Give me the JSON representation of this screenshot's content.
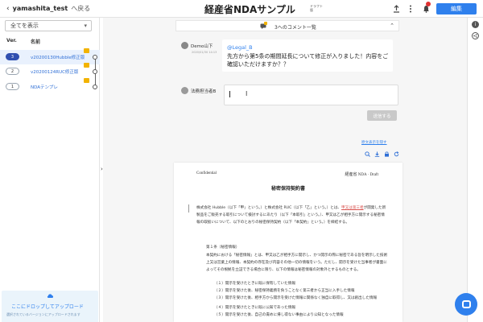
{
  "header": {
    "back_project": "yamashita_test",
    "back_label": "へ戻る",
    "title": "経産省NDAサンプル",
    "title_badge": "ドラフト版",
    "edit_button": "編集",
    "icons": [
      "upload-icon",
      "more-vertical-icon",
      "bell-icon"
    ]
  },
  "sidebar": {
    "filter_value": "全てを表示",
    "columns": {
      "version": "Ver.",
      "name": "名前"
    },
    "versions": [
      {
        "ver": "3",
        "name": "v20200130Hubble修正版",
        "active": true
      },
      {
        "ver": "2",
        "name": "v20200124RUC修正版",
        "active": false
      },
      {
        "ver": "1",
        "name": "NDAテンプレ",
        "active": false
      }
    ],
    "dropzone": {
      "title": "ここにドロップしてアップロード",
      "subtitle": "選択されているバージョンにアップロードされます"
    }
  },
  "comments": {
    "header_label": "3へのコメント一覧",
    "items": [
      {
        "author": "Demo山下",
        "time": "2020/01/30 14:13",
        "mention": "@Legal_B",
        "body": "先方から第5条の期間延長について修正が入りました！内容をご確認いただけますか？？"
      }
    ],
    "reply_author": "法務担当者B",
    "reply_button": "送信する",
    "hide_link": "原文表示を隠す"
  },
  "document": {
    "left_header": "Confidential",
    "right_header": "経産省 NDA · Draft",
    "title": "秘密保持契約書",
    "para_pre": "株式会社 Hubble（以下「甲」という。）と株式会社 RUC（以下「乙」という。）とは、",
    "para_hl": "甲又は第三者",
    "para_post": "が開発した新製品をご販売する取引について検討するにあたり（以下「本取引」という。）、甲又は乙が相手方に開示する秘密情報の取扱いについて、以下のとおりの秘密保持契約（以下「本契約」という。）を締結する。",
    "article_title": "第１条（秘密情報）",
    "article_body": "本契約における「秘密情報」とは、甲又は乙が相手方に開示し、かつ開示の際に秘密である旨を明示した技術上又は営業上の情報、本契約の存在及び内容その他一切の情報をいう。ただし、開示を受けた当事者が書面によってその根拠を立証できる場合に限り、以下の情報は秘密情報の対象外とするものとする。",
    "items": [
      "（１）開示を受けたときに既に保有していた情報",
      "（２）開示を受けた後、秘密保持義務を負うことなく第三者から正当に入手した情報",
      "（３）開示を受けた後、相手方から開示を受けた情報に関係なく独自に取得し、又は創出した情報",
      "（４）開示を受けたときに既に公知であった情報",
      "（５）開示を受けた後、自己の責めに帰し得ない事由により公知となった情報"
    ]
  },
  "colors": {
    "accent": "#2f80ed",
    "active_version": "#2f4fb0",
    "badge": "#f2b300",
    "highlight": "#d9534f"
  }
}
